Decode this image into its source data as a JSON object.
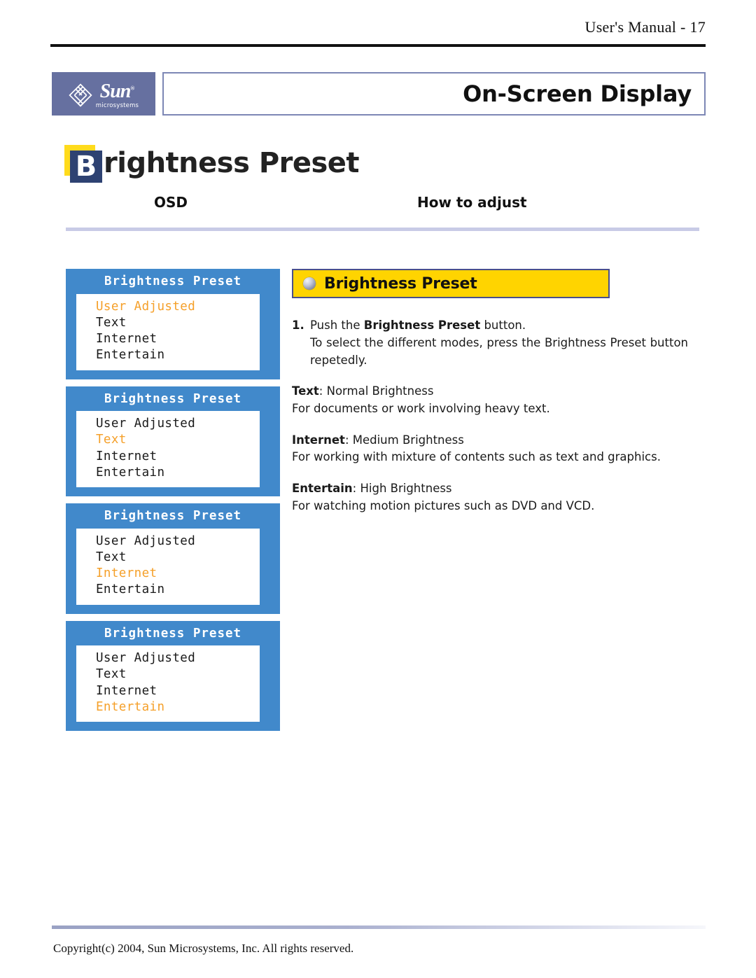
{
  "header": {
    "manual_label": "User's Manual - 17",
    "logo": {
      "mark": "sun-pinwheel-icon",
      "wordmark": "Sun",
      "trademark": "®",
      "subtext": "microsystems"
    },
    "section_title": "On-Screen Display"
  },
  "page_title": {
    "badge_letter": "B",
    "rest": "rightness Preset",
    "badge_back_color": "#ffdb1c",
    "badge_front_color": "#2e4272"
  },
  "columns": {
    "left_header": "OSD",
    "right_header": "How to adjust"
  },
  "osd": {
    "panel_color": "#4189cb",
    "selected_color": "#f5a02a",
    "panels": [
      {
        "title": "Brightness Preset",
        "items": [
          {
            "label": "User Adjusted",
            "selected": true
          },
          {
            "label": "Text",
            "selected": false
          },
          {
            "label": "Internet",
            "selected": false
          },
          {
            "label": "Entertain",
            "selected": false
          }
        ]
      },
      {
        "title": "Brightness Preset",
        "items": [
          {
            "label": "User Adjusted",
            "selected": false
          },
          {
            "label": "Text",
            "selected": true
          },
          {
            "label": "Internet",
            "selected": false
          },
          {
            "label": "Entertain",
            "selected": false
          }
        ]
      },
      {
        "title": "Brightness Preset",
        "items": [
          {
            "label": "User Adjusted",
            "selected": false
          },
          {
            "label": "Text",
            "selected": false
          },
          {
            "label": "Internet",
            "selected": true
          },
          {
            "label": "Entertain",
            "selected": false
          }
        ]
      },
      {
        "title": "Brightness Preset",
        "items": [
          {
            "label": "User Adjusted",
            "selected": false
          },
          {
            "label": "Text",
            "selected": false
          },
          {
            "label": "Internet",
            "selected": false
          },
          {
            "label": "Entertain",
            "selected": true
          }
        ]
      }
    ]
  },
  "howto": {
    "banner": {
      "label": "Brightness Preset",
      "bullet_icon": "sphere-bullet-icon",
      "bg_color": "#ffd400",
      "border_color": "#4a4f8c"
    },
    "step_number": "1.",
    "step_line1_prefix": "Push the ",
    "step_line1_bold": "Brightness Preset",
    "step_line1_suffix": " button.",
    "step_line2": "To select the different modes, press the Brightness Preset button repetedly.",
    "modes": [
      {
        "name": "Text",
        "head_rest": ": Normal Brightness",
        "desc": "For documents or work involving heavy text."
      },
      {
        "name": "Internet",
        "head_rest": ": Medium Brightness",
        "desc": "For working with mixture of contents such as text and graphics."
      },
      {
        "name": "Entertain",
        "head_rest": ": High Brightness",
        "desc": "For watching motion pictures such as DVD and VCD."
      }
    ]
  },
  "footer": {
    "copyright": "Copyright(c) 2004, Sun Microsystems, Inc. All rights reserved."
  }
}
